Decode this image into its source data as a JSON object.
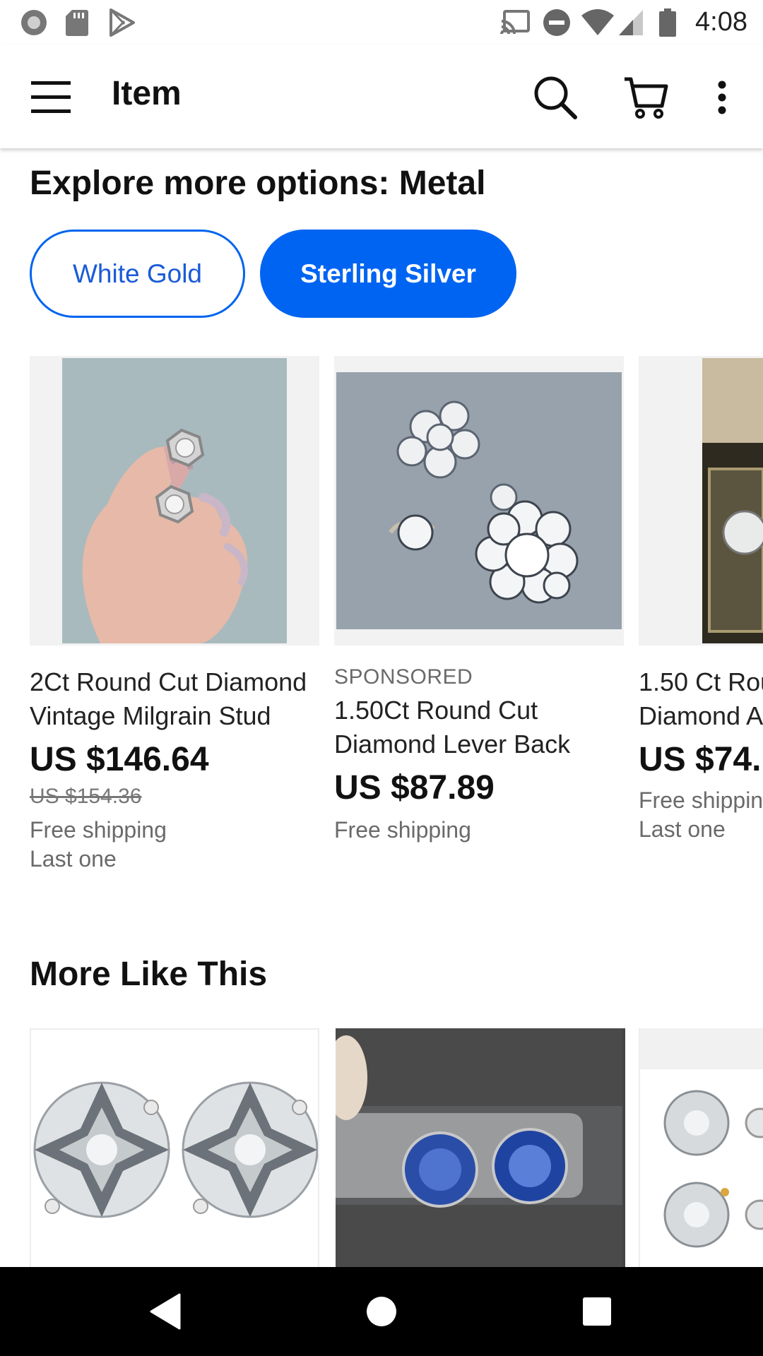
{
  "status_bar": {
    "time": "4:08",
    "left_icons": [
      "circle-notification-icon",
      "sd-card-icon",
      "play-store-icon"
    ],
    "right_icons": [
      "cast-icon",
      "do-not-disturb-icon",
      "wifi-icon",
      "signal-icon",
      "battery-icon"
    ]
  },
  "app_bar": {
    "title": "Item",
    "icons": [
      "menu-icon",
      "search-icon",
      "cart-icon",
      "more-vert-icon"
    ]
  },
  "explore": {
    "title": "Explore more options: Metal",
    "chips": [
      {
        "label": "White Gold",
        "selected": false
      },
      {
        "label": "Sterling Silver",
        "selected": true
      }
    ],
    "accent_color": "#0064F2"
  },
  "listings": [
    {
      "title_line1": "2Ct Round Cut Diamond",
      "title_line2": "Vintage Milgrain Stud",
      "price": "US $146.64",
      "original_price": "US $154.36",
      "shipping": "Free shipping",
      "stock": "Last one"
    },
    {
      "sponsored": "SPONSORED",
      "title_line1": "1.50Ct Round Cut",
      "title_line2": "Diamond Lever Back",
      "price": "US $87.89",
      "shipping": "Free shipping"
    },
    {
      "title_line1": "1.50 Ct Rou",
      "title_line2": "Diamond A",
      "price": "US $74.",
      "shipping": "Free shippin",
      "stock": "Last one"
    }
  ],
  "more_like_this": {
    "title": "More Like This"
  },
  "nav_bar": {
    "icons": [
      "back-icon",
      "home-icon",
      "recents-icon"
    ]
  }
}
